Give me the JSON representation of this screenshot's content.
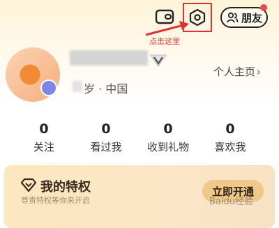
{
  "header": {
    "wallet_icon": "wallet-icon",
    "settings_icon": "hexagon-settings-icon",
    "friends_label": "朋友",
    "friends_icon": "people-icon",
    "annotation_text": "点击这里",
    "annotation_color": "#e0322e"
  },
  "profile": {
    "age_location": "岁 · 中国",
    "profile_link_label": "个人主页",
    "profile_link_chevron": "›",
    "vip_icon": "v-badge-icon"
  },
  "stats": [
    {
      "count": "0",
      "label": "关注"
    },
    {
      "count": "0",
      "label": "看过我"
    },
    {
      "count": "0",
      "label": "收到礼物"
    },
    {
      "count": "0",
      "label": "喜欢我"
    }
  ],
  "privilege": {
    "title": "我的特权",
    "subtitle": "尊贵特权等你来开启",
    "button_label": "立即开通",
    "icon": "diamond-icon"
  },
  "watermark": "Baidu经验"
}
